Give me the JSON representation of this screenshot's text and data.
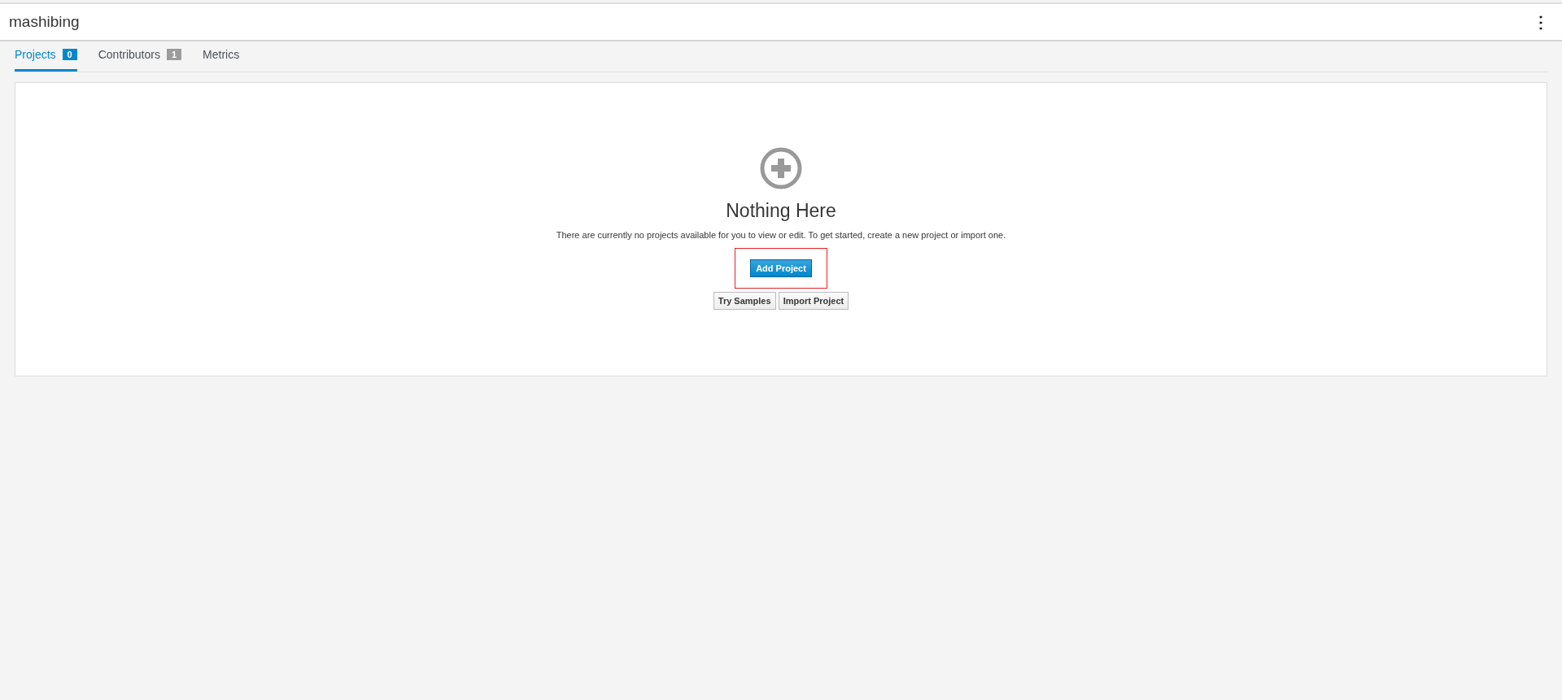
{
  "header": {
    "title": "mashibing",
    "menu_icon": "⋮"
  },
  "tabs": [
    {
      "label": "Projects",
      "count": "0",
      "selected": true
    },
    {
      "label": "Contributors",
      "count": "1",
      "selected": false
    },
    {
      "label": "Metrics",
      "selected": false
    }
  ],
  "empty_state": {
    "title": "Nothing Here",
    "description": "There are currently no projects available for you to view or edit. To get started, create a new project or import one.",
    "primary_button": {
      "label": "Add Project",
      "highlighted": true
    },
    "secondary_buttons": [
      "Try Samples",
      "Import Project"
    ]
  }
}
